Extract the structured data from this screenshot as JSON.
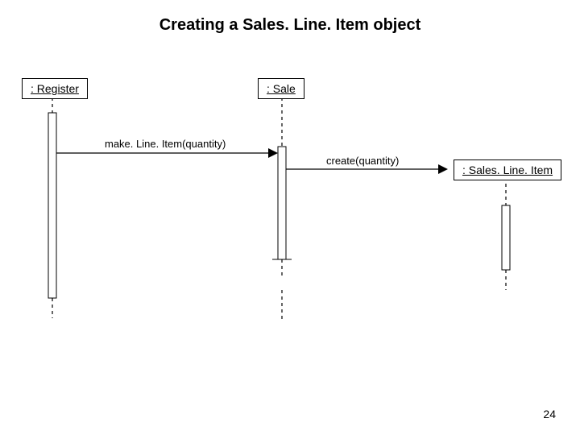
{
  "title": "Creating a Sales. Line. Item object",
  "objects": {
    "register": ": Register",
    "sale": ": Sale",
    "salesLineItem": ": Sales. Line. Item"
  },
  "messages": {
    "makeLineItem": "make. Line. Item(quantity)",
    "create": "create(quantity)"
  },
  "page_number": "24"
}
